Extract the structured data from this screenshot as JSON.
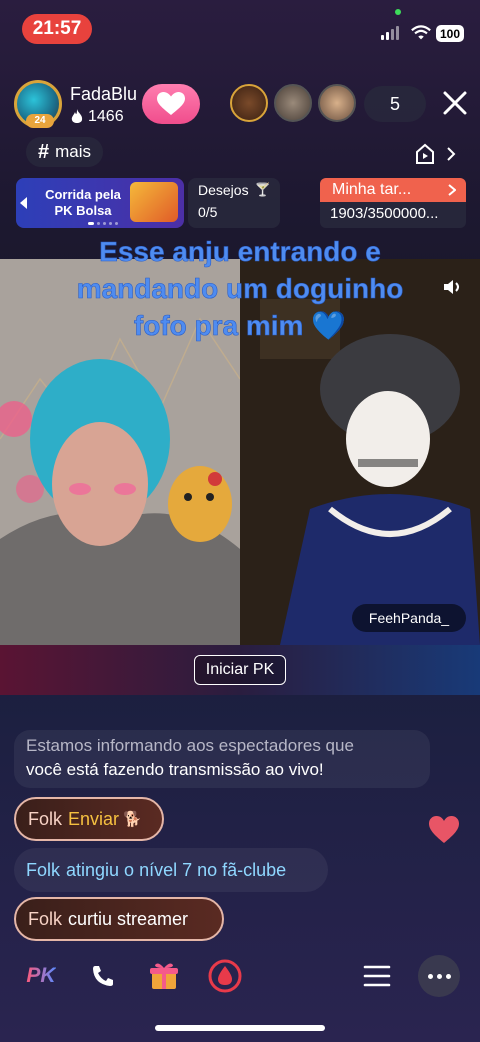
{
  "status_bar": {
    "time": "21:57",
    "battery": "100"
  },
  "host": {
    "name": "FadaBlu",
    "likes": "1466",
    "level": "24"
  },
  "header": {
    "viewer_count": "5"
  },
  "tag": {
    "label": "mais"
  },
  "banners": {
    "pk_bolsa": {
      "line1": "Corrida pela",
      "line2": "PK Bolsa"
    },
    "desejos": {
      "label": "Desejos",
      "progress": "0/5"
    },
    "task": {
      "title": "Minha tar...",
      "progress": "1903/3500000..."
    }
  },
  "stream": {
    "caption": "Esse anju entrando e mandando um doguinho fofo pra mim 💙",
    "opponent_name": "FeehPanda_",
    "start_pk_label": "Iniciar PK"
  },
  "chat": {
    "system_line1": "Estamos informando aos espectadores que",
    "system_line2": "você está fazendo transmissão ao vivo!",
    "messages": [
      {
        "user": "Folk",
        "text": "Enviar"
      },
      {
        "user": "Folk",
        "text": "atingiu o nível 7 no fã-clube"
      },
      {
        "user": "Folk",
        "text": "curtiu streamer"
      }
    ]
  },
  "toolbar": {
    "pk_label": "PK"
  },
  "colors": {
    "accent_red": "#e8423d",
    "follow_pink": "#f04d8c",
    "task_orange": "#f0624d",
    "caption_blue": "#4f8cf0"
  }
}
